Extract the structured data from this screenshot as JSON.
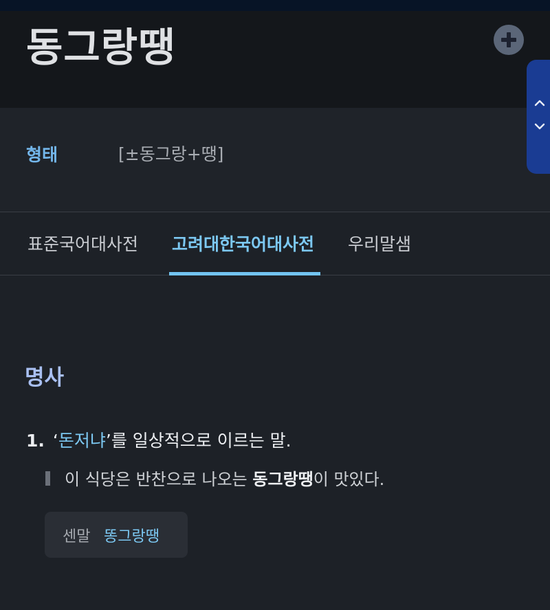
{
  "entry": {
    "title": "동그랑땡"
  },
  "header": {
    "add_icon": "plus-circle-icon",
    "nav_up_icon": "chevron-up-icon",
    "nav_down_icon": "chevron-down-icon"
  },
  "form": {
    "label": "형태",
    "value": "[±동그랑+땡]"
  },
  "tabs": [
    {
      "label": "표준국어대사전",
      "active": false
    },
    {
      "label": "고려대한국어대사전",
      "active": true
    },
    {
      "label": "우리말샘",
      "active": false
    }
  ],
  "sense": {
    "pos": "명사",
    "number": "1.",
    "def_open": "‘",
    "def_link": "돈저냐",
    "def_rest": "’를 일상적으로 이르는 말.",
    "example_before": "이 식당은 반찬으로 나오는 ",
    "example_bold": "동그랑땡",
    "example_after": "이 맛있다.",
    "related_label": "센말",
    "related_word": "똥그랑땡"
  },
  "colors": {
    "accent": "#7cc8f2",
    "pos": "#a9c0f2",
    "nav_pill": "#1a3c93",
    "background": "#1d2127"
  }
}
